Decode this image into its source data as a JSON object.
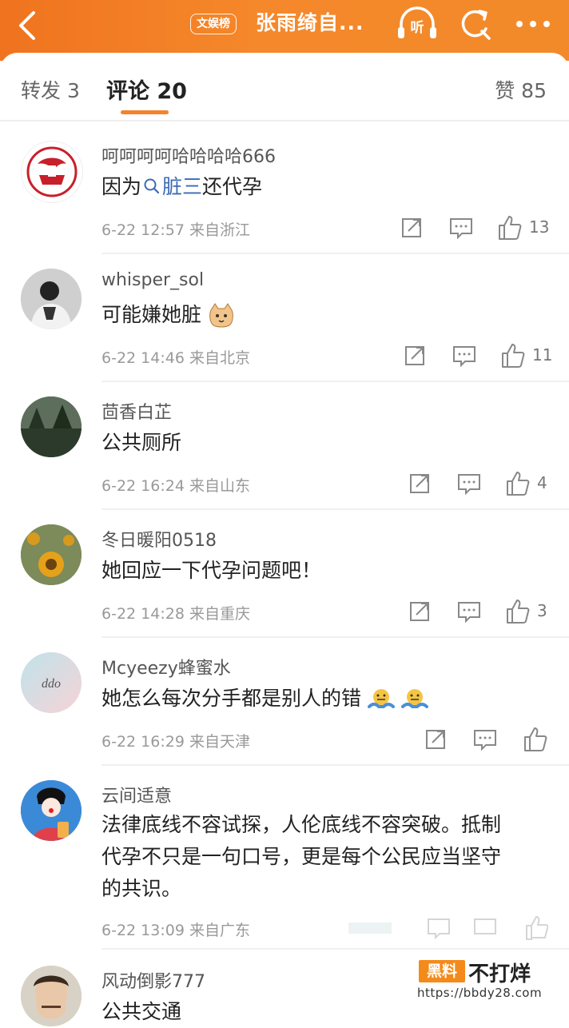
{
  "topbar": {
    "badge": "文娱榜",
    "title": "张雨绮自...",
    "listen_label": "听"
  },
  "tabs": {
    "repost": "转发 3",
    "comments": "评论 20",
    "likes": "赞 85"
  },
  "comments": [
    {
      "username": "呵呵呵呵哈哈哈哈666",
      "text_prefix": "因为",
      "topic": "脏三",
      "text_suffix": "还代孕",
      "meta": "6-22 12:57 来自浙江",
      "likes": "13"
    },
    {
      "username": "whisper_sol",
      "text": "可能嫌她脏",
      "meta": "6-22 14:46 来自北京",
      "likes": "11"
    },
    {
      "username": "茴香白芷",
      "text": "公共厕所",
      "meta": "6-22 16:24 来自山东",
      "likes": "4"
    },
    {
      "username": "冬日暖阳0518",
      "text": "她回应一下代孕问题吧！",
      "meta": "6-22 14:28 来自重庆",
      "likes": "3"
    },
    {
      "username": "Mcyeezy蜂蜜水",
      "text": "她怎么每次分手都是别人的错",
      "meta": "6-22 16:29 来自天津",
      "likes": ""
    },
    {
      "username": "云间适意",
      "lines": [
        "法律底线不容试探，人伦底线不容突破。抵制",
        "代孕不只是一句口号，更是每个公民应当坚守",
        "的共识。"
      ],
      "meta": "6-22 13:09 来自广东"
    },
    {
      "username": "风动倒影777",
      "text": "公共交通"
    }
  ],
  "watermark": {
    "brand_box": "黑料",
    "brand_text": "不打烊",
    "url": "https://bbdy28.com"
  },
  "colors": {
    "topbar": "#f5832b",
    "accent": "#f5832b",
    "link": "#3b6bb3"
  },
  "icons": [
    "back-icon",
    "listen-icon",
    "refresh-icon",
    "more-icon",
    "search-icon",
    "share-icon",
    "comment-icon",
    "like-icon"
  ]
}
